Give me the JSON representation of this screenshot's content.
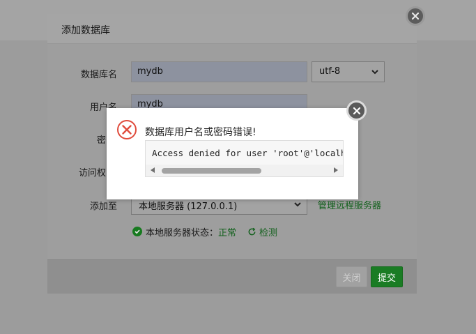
{
  "dialog": {
    "title": "添加数据库",
    "fields": {
      "db_name_label": "数据库名",
      "db_name_value": "mydb",
      "charset_value": "utf-8",
      "username_label": "用户名",
      "username_value": "mydb",
      "password_label": "密",
      "access_label": "访问权",
      "add_to_label": "添加至",
      "server_value": "本地服务器 (127.0.0.1)",
      "manage_remote_link": "管理远程服务器"
    },
    "status": {
      "label": "本地服务器状态：",
      "value": "正常",
      "check_link": "检测"
    },
    "buttons": {
      "close_label": "关闭",
      "submit_label": "提交"
    }
  },
  "error_popup": {
    "message": "数据库用户名或密码错误!",
    "detail": "Access denied for user 'root'@'localhost'"
  },
  "colors": {
    "accent_green": "#1a7c24",
    "error_red": "#e04b3c"
  },
  "icons": {
    "dialog_close": "close-icon",
    "popup_close": "close-icon",
    "error": "error-circle-icon",
    "status_ok": "check-circle-icon",
    "refresh": "refresh-icon",
    "select_arrow": "chevron-down-icon"
  }
}
